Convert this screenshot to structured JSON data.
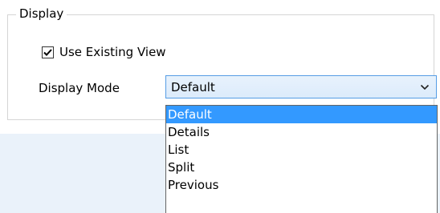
{
  "group": {
    "title": "Display"
  },
  "use_existing_view": {
    "label": "Use Existing View",
    "checked": true
  },
  "display_mode": {
    "label": "Display Mode",
    "selected_value": "Default",
    "options": [
      "Default",
      "Details",
      "List",
      "Split",
      "Previous"
    ],
    "highlighted_index": 0
  },
  "colors": {
    "combo_border": "#569de5",
    "selection_background": "#3399ff",
    "selection_text": "#ffffff",
    "groupbox_border": "#d5d5d5",
    "background_band": "#eaf2fa"
  },
  "icons": {
    "checkbox_mark": "checkmark-icon",
    "combo_arrow": "chevron-down-icon"
  }
}
